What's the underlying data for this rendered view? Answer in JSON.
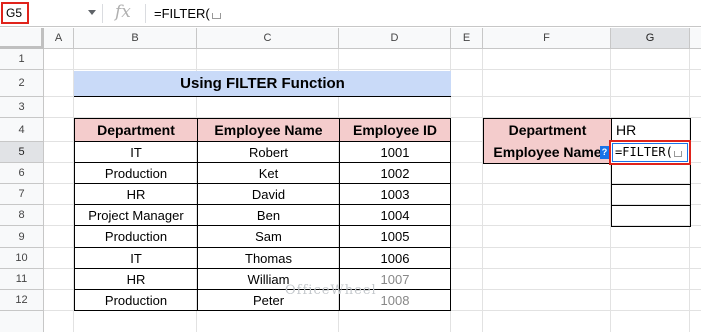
{
  "formula_bar": {
    "name_box": "G5",
    "fx_icon": "fx",
    "formula": "=FILTER("
  },
  "columns": [
    "A",
    "B",
    "C",
    "D",
    "E",
    "F",
    "G"
  ],
  "rows": [
    "1",
    "2",
    "3",
    "4",
    "5",
    "6",
    "7",
    "8",
    "9",
    "10",
    "11",
    "12"
  ],
  "title": "Using FILTER Function",
  "table": {
    "headers": [
      "Department",
      "Employee Name",
      "Employee ID"
    ],
    "rows": [
      [
        "IT",
        "Robert",
        "1001"
      ],
      [
        "Production",
        "Ket",
        "1002"
      ],
      [
        "HR",
        "David",
        "1003"
      ],
      [
        "Project Manager",
        "Ben",
        "1004"
      ],
      [
        "Production",
        "Sam",
        "1005"
      ],
      [
        "IT",
        "Thomas",
        "1006"
      ],
      [
        "HR",
        "William",
        "1007"
      ],
      [
        "Production",
        "Peter",
        "1008"
      ]
    ]
  },
  "criteria": {
    "dept_label": "Department",
    "dept_value": "HR",
    "name_label": "Employee Name",
    "active_formula": "=FILTER(",
    "help_icon": "?"
  },
  "watermark": "OfficeWheel",
  "colors": {
    "title_bg": "#c9daf8",
    "header_bg": "#f4cccc",
    "active_border": "#e0231b",
    "selection": "#1a73e8"
  }
}
